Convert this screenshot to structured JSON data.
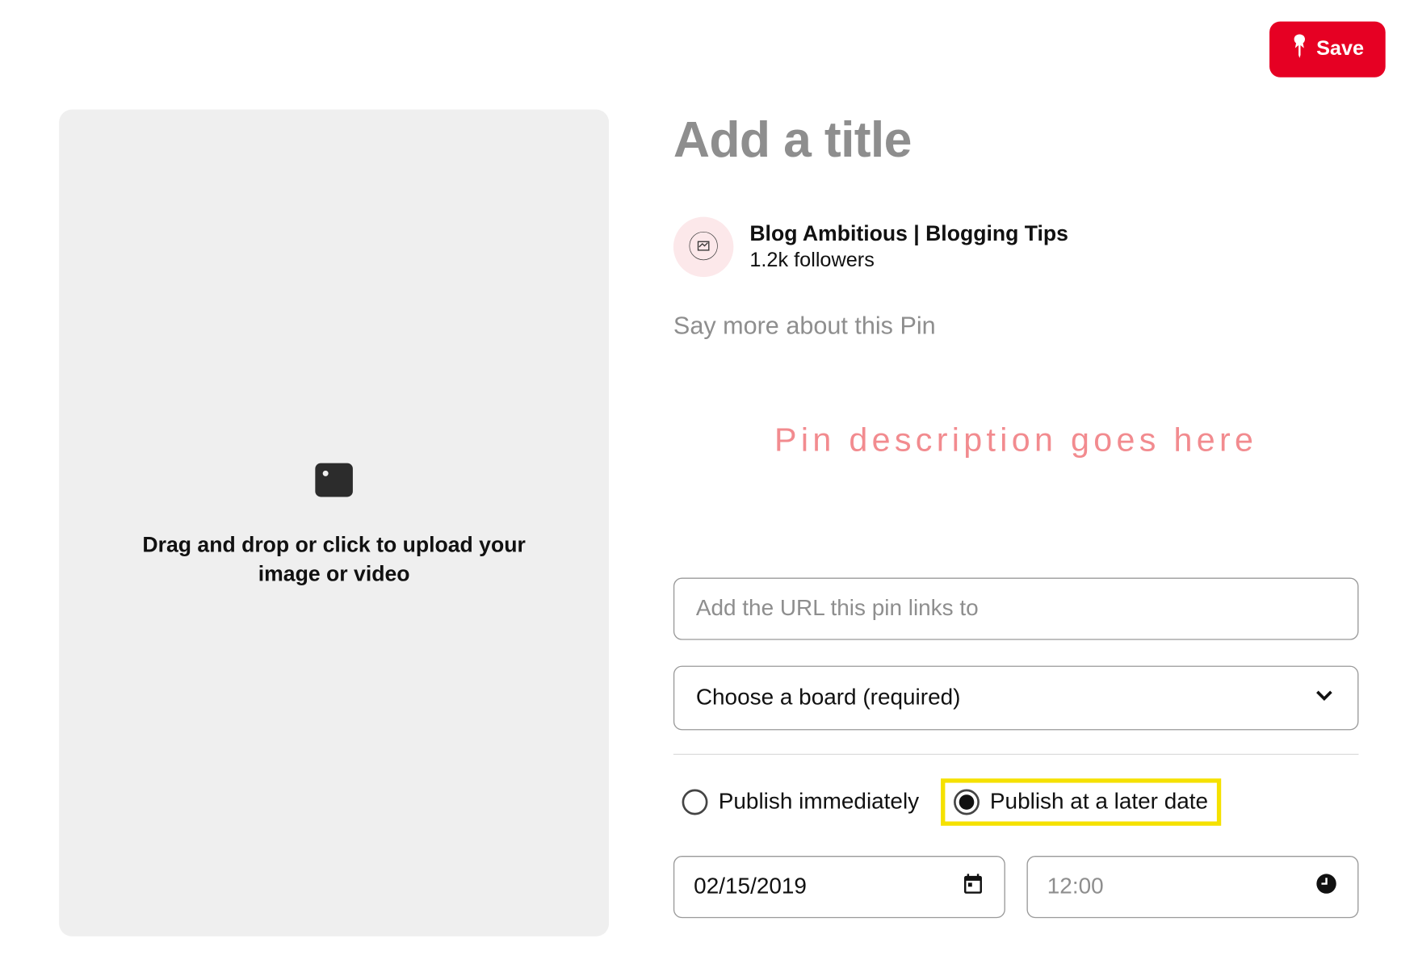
{
  "header": {
    "save_label": "Save"
  },
  "upload": {
    "text": "Drag and drop or click to upload your image or video"
  },
  "form": {
    "title_placeholder": "Add a title",
    "description_placeholder": "Say more about this Pin",
    "description_annotation": "Pin description goes here",
    "url_placeholder": "Add the URL this pin links to",
    "board_placeholder": "Choose a board (required)",
    "date_value": "02/15/2019",
    "time_value": "12:00"
  },
  "profile": {
    "name": "Blog Ambitious | Blogging Tips",
    "followers": "1.2k followers",
    "avatar_alt": "BLOG AMBITIOUS"
  },
  "publish": {
    "immediate_label": "Publish immediately",
    "later_label": "Publish at a later date",
    "selected": "later"
  }
}
